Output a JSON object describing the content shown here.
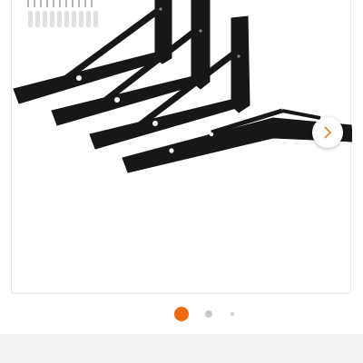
{
  "gallery": {
    "image_alt": "",
    "current_slide": 1,
    "total_dots": 3,
    "next_icon": "chevron-right-icon"
  },
  "colors": {
    "active_dot": "#f26a10",
    "inactive_dot": "#c8c8c8",
    "inactive_dot_small": "#c8c8c8",
    "bracket": "#171717",
    "footer": "#f2f2f2"
  }
}
